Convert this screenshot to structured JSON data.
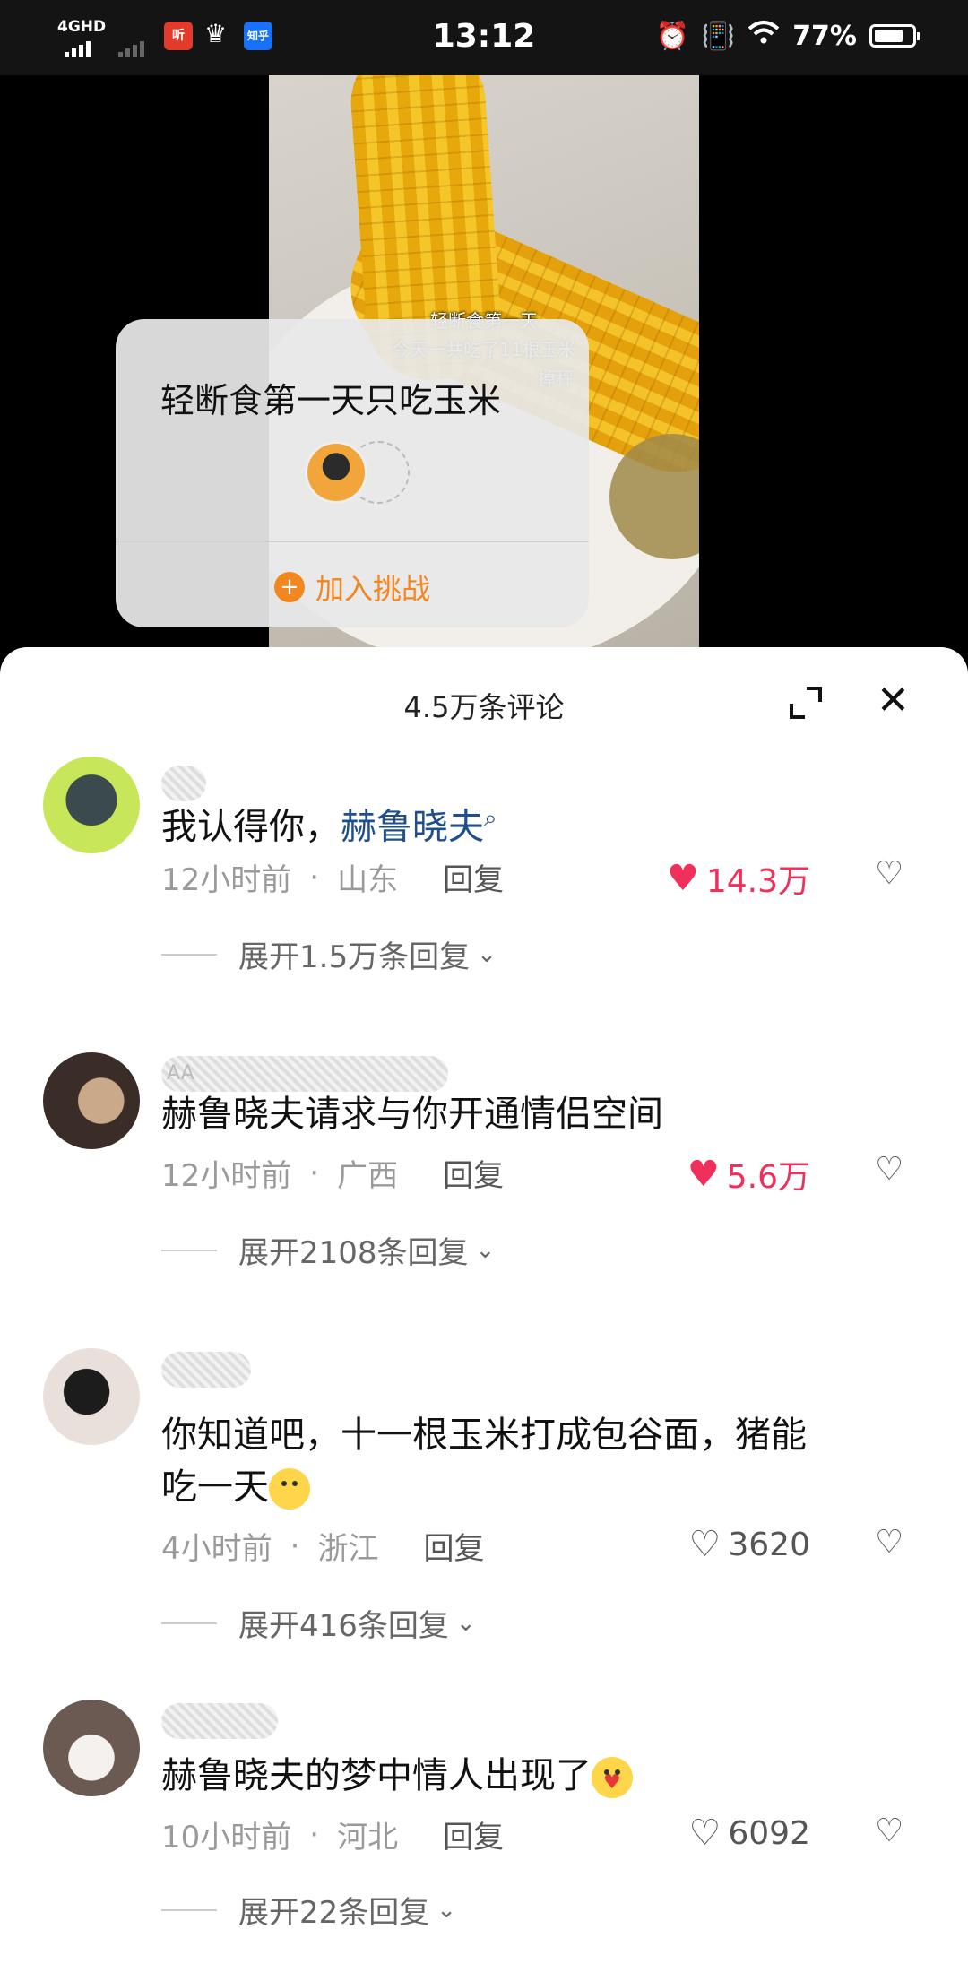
{
  "status_bar": {
    "network": "4GHD",
    "app_icon_1": "听",
    "app_icon_2": "知乎",
    "time": "13:12",
    "battery": "77%",
    "battery_level": 0.77
  },
  "video": {
    "overlay_line1": "轻断食第一天",
    "overlay_line2": "今天一共吃了11根玉米",
    "overlay_line3": "掉秤"
  },
  "challenge_card": {
    "title": "轻断食第一天只吃玉米",
    "join_label": "加入挑战",
    "join_icon": "plus-icon"
  },
  "comments_panel": {
    "header": "4.5万条评论",
    "expand_icon": "expand-icon",
    "close_icon": "close-icon",
    "comments": [
      {
        "text": "我认得你，",
        "mention": "赫鲁晓夫",
        "time": "12小时前",
        "location": "山东",
        "reply": "回复",
        "likes": "14.3万",
        "liked": true,
        "expand": "展开1.5万条回复"
      },
      {
        "username": "AA",
        "text": "赫鲁晓夫请求与你开通情侣空间",
        "time": "12小时前",
        "location": "广西",
        "reply": "回复",
        "likes": "5.6万",
        "liked": true,
        "expand": "展开2108条回复"
      },
      {
        "text_line1": "你知道吧，十一根玉米打成包谷面，猪能",
        "text_line2": "吃一天",
        "time": "4小时前",
        "location": "浙江",
        "reply": "回复",
        "likes": "3620",
        "liked": false,
        "expand": "展开416条回复"
      },
      {
        "text": "赫鲁晓夫的梦中情人出现了",
        "time": "10小时前",
        "location": "河北",
        "reply": "回复",
        "likes": "6092",
        "liked": false,
        "expand": "展开22条回复"
      }
    ]
  }
}
